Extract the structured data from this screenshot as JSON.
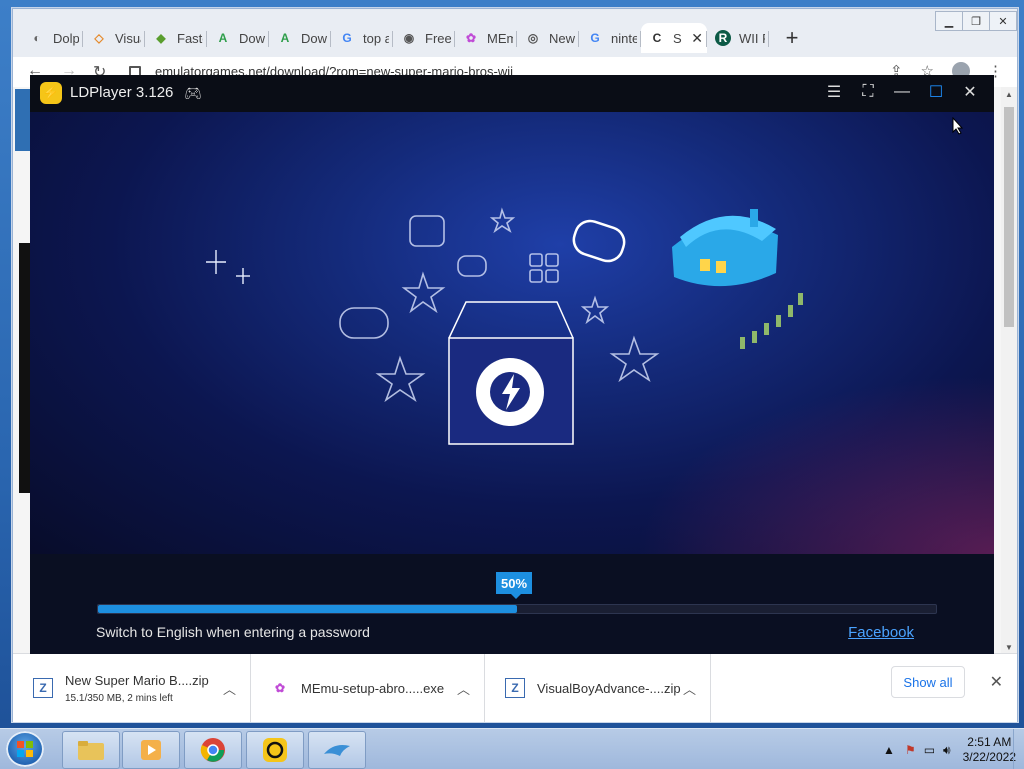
{
  "browser": {
    "tabs": [
      {
        "label": "Dolp",
        "favicon": "dolphin-icon"
      },
      {
        "label": "Visua",
        "favicon": "visualboy-icon"
      },
      {
        "label": "Faste",
        "favicon": "bluestacks-icon"
      },
      {
        "label": "Dow",
        "favicon": "apk-icon"
      },
      {
        "label": "Dow",
        "favicon": "apk-icon"
      },
      {
        "label": "top a",
        "favicon": "google-icon"
      },
      {
        "label": "Free",
        "favicon": "globe-icon"
      },
      {
        "label": "MEm",
        "favicon": "memu-icon"
      },
      {
        "label": "New",
        "favicon": "chrome-icon"
      },
      {
        "label": "ninte",
        "favicon": "google-icon"
      },
      {
        "label": "S",
        "favicon": "site-icon"
      },
      {
        "label": "WII R",
        "favicon": "r-icon"
      }
    ],
    "url": "emulatorgames.net/download/?rom=new-super-mario-bros-wii"
  },
  "downloads": [
    {
      "name": "New Super Mario B....zip",
      "sub": "15.1/350 MB, 2 mins left"
    },
    {
      "name": "MEmu-setup-abro.....exe",
      "sub": ""
    },
    {
      "name": "VisualBoyAdvance-....zip",
      "sub": ""
    }
  ],
  "download_bar": {
    "show_all": "Show all"
  },
  "ldplayer": {
    "title": "LDPlayer 3.126",
    "progress_label": "50%",
    "progress": 0.5,
    "hint": "Switch to English when entering a password",
    "link": "Facebook"
  },
  "taskbar": {
    "time": "2:51 AM",
    "date": "3/22/2022"
  },
  "colors": {
    "accent": "#1d8fe0",
    "ld_bg": "#0b1024",
    "link": "#4aa3ff"
  }
}
